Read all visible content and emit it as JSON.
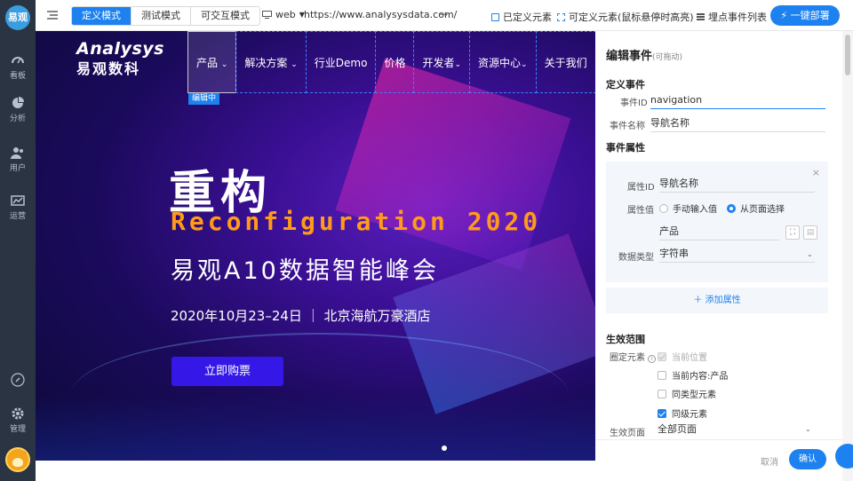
{
  "sidebar": {
    "logo": "易观",
    "items": [
      {
        "label": "看板",
        "icon": "dashboard-icon"
      },
      {
        "label": "分析",
        "icon": "pie-chart-icon"
      },
      {
        "label": "用户",
        "icon": "users-icon"
      },
      {
        "label": "运营",
        "icon": "operations-icon"
      },
      {
        "label": "",
        "icon": "link-icon"
      },
      {
        "label": "管理",
        "icon": "gear-icon"
      }
    ]
  },
  "toolbar": {
    "modes": [
      "定义模式",
      "测试模式",
      "可交互模式"
    ],
    "active_mode": "定义模式",
    "platform": "web",
    "url": "https://www.analysysdata.com/",
    "defined_elements": "已定义元素",
    "definable_elements": "可定义元素(鼠标悬停时高亮)",
    "event_list": "埋点事件列表",
    "deploy": "一键部署"
  },
  "site": {
    "brand_en": "Analysys",
    "brand_cn": "易观数科",
    "nav": [
      "产品",
      "解决方案",
      "行业Demo",
      "价格",
      "开发者",
      "资源中心",
      "关于我们"
    ],
    "editing_tag": "编辑中",
    "hero_title": "重构",
    "hero_en": "Reconfiguration 2020",
    "hero_sub": "易观A10数据智能峰会",
    "hero_date": "2020年10月23–24日 ｜ 北京海航万豪酒店",
    "buy_button": "立即购票"
  },
  "panel": {
    "title": "编辑事件",
    "title_hint": "(可拖动)",
    "define_event": "定义事件",
    "event_id_label": "事件ID",
    "event_id_value": "navigation",
    "event_name_label": "事件名称",
    "event_name_value": "导航名称",
    "event_props": "事件属性",
    "prop_id_label": "属性ID",
    "prop_id_value": "导航名称",
    "prop_value_label": "属性值",
    "radio_manual": "手动输入值",
    "radio_page": "从页面选择",
    "page_value": "产品",
    "data_type_label": "数据类型",
    "data_type_value": "字符串",
    "add_prop": "添加属性",
    "scope_title": "生效范围",
    "circle_label": "圈定元素",
    "opt_current_pos": "当前位置",
    "opt_current_content": "当前内容:产品",
    "opt_same_type": "同类型元素",
    "opt_same_level": "同级元素",
    "effective_page_label": "生效页面",
    "effective_page_value": "全部页面",
    "cancel": "取消",
    "confirm": "确认"
  }
}
